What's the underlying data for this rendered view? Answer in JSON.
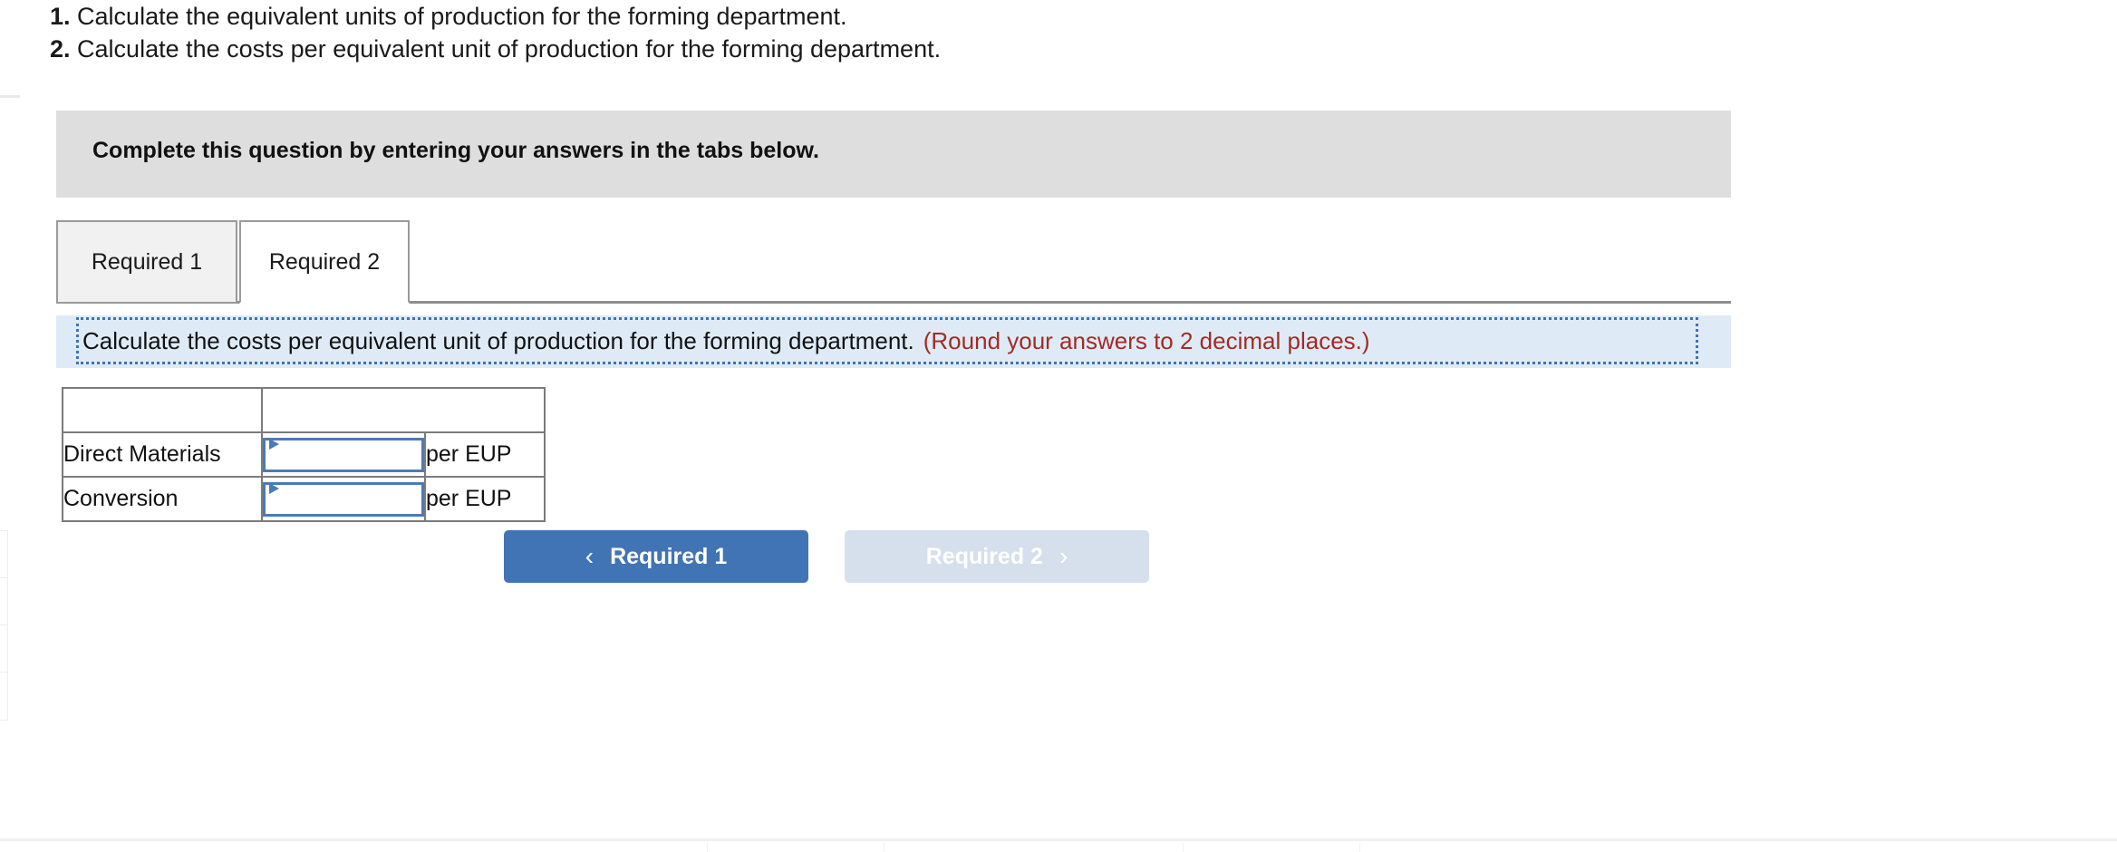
{
  "questions": [
    {
      "num": "1.",
      "text": "Calculate the equivalent units of production for the forming department."
    },
    {
      "num": "2.",
      "text": "Calculate the costs per equivalent unit of production for the forming department."
    }
  ],
  "instruction_banner": {
    "text": "Complete this question by entering your answers in the tabs below."
  },
  "tabs": [
    {
      "label": "Required 1",
      "active": false
    },
    {
      "label": "Required 2",
      "active": true
    }
  ],
  "prompt": {
    "main": "Calculate the costs per equivalent unit of production for the forming department.",
    "round_note": "(Round your answers to 2 decimal places.)"
  },
  "answer_table": {
    "header": [
      "",
      ""
    ],
    "rows": [
      {
        "label": "Direct Materials",
        "value": "",
        "placeholder": "",
        "unit": "per EUP"
      },
      {
        "label": "Conversion",
        "value": "",
        "placeholder": "",
        "unit": "per EUP"
      }
    ]
  },
  "nav": {
    "prev_label": "Required 1",
    "prev_chevron": "‹",
    "next_label": "Required 2",
    "next_chevron": "›"
  },
  "colors": {
    "banner_gray": "#dedede",
    "prompt_blue_bg": "#deebf7",
    "prompt_border_blue": "#3f72b5",
    "round_note_red": "#a42a24",
    "table_header_blue": "#80aadd",
    "input_border_blue": "#4a7bb8",
    "button_primary": "#4174b4",
    "button_disabled": "#d6dfec",
    "tab_inactive_bg": "#f1f1f1",
    "tab_border": "#9a9a9a"
  }
}
